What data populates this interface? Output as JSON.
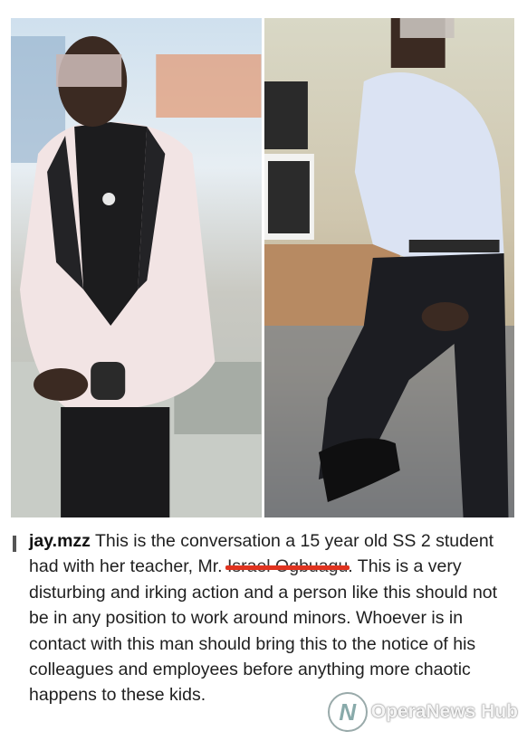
{
  "caption": {
    "username": "jay.mzz",
    "text_before": "This is the conversation a 15 year old SS 2 student had with her teacher, Mr. ",
    "redacted_name": "Israel Ogbuagu",
    "text_after": ". This is a very disturbing and irking action and a person like this should not be in any position to work around minors. Whoever is in contact with this man should bring this to the notice of his colleagues and employees before anything more chaotic happens to these kids."
  },
  "watermark": {
    "brand": "OperaNews Hub",
    "logo_letter": "N"
  },
  "colors": {
    "redaction": "#e0331f",
    "text": "#1f1f1f"
  }
}
